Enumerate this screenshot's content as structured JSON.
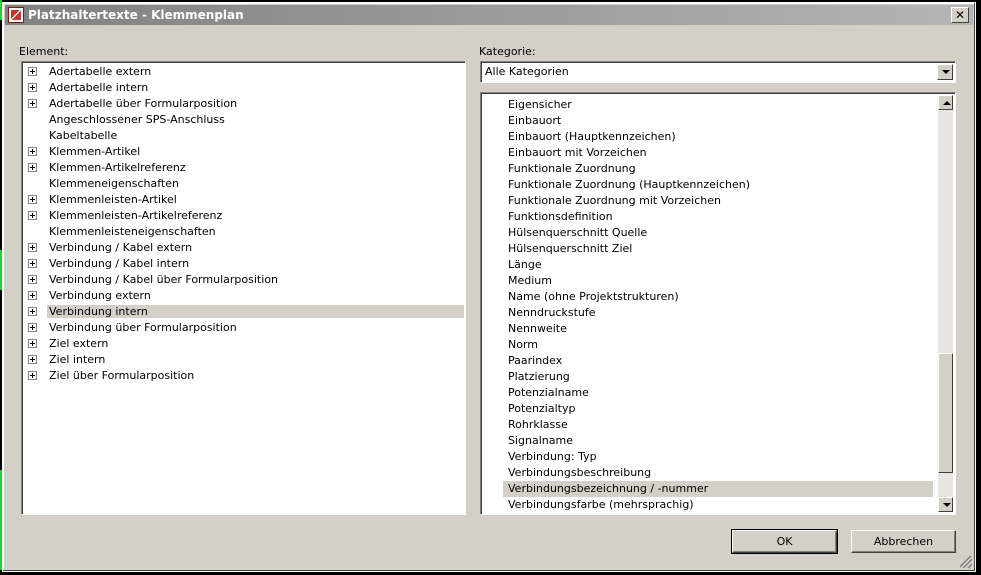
{
  "window": {
    "title": "Platzhaltertexte - Klemmenplan",
    "close_icon": "close-icon"
  },
  "left": {
    "label": "Element:",
    "items": [
      {
        "label": "Adertabelle extern",
        "expandable": true
      },
      {
        "label": "Adertabelle intern",
        "expandable": true
      },
      {
        "label": "Adertabelle über Formularposition",
        "expandable": true
      },
      {
        "label": "Angeschlossener SPS-Anschluss",
        "expandable": false
      },
      {
        "label": "Kabeltabelle",
        "expandable": false
      },
      {
        "label": "Klemmen-Artikel",
        "expandable": true
      },
      {
        "label": "Klemmen-Artikelreferenz",
        "expandable": true
      },
      {
        "label": "Klemmeneigenschaften",
        "expandable": false
      },
      {
        "label": "Klemmenleisten-Artikel",
        "expandable": true
      },
      {
        "label": "Klemmenleisten-Artikelreferenz",
        "expandable": true
      },
      {
        "label": "Klemmenleisteneigenschaften",
        "expandable": false
      },
      {
        "label": "Verbindung / Kabel extern",
        "expandable": true
      },
      {
        "label": "Verbindung / Kabel intern",
        "expandable": true
      },
      {
        "label": "Verbindung / Kabel über Formularposition",
        "expandable": true
      },
      {
        "label": "Verbindung extern",
        "expandable": true
      },
      {
        "label": "Verbindung intern",
        "expandable": true,
        "selected": true
      },
      {
        "label": "Verbindung über Formularposition",
        "expandable": true
      },
      {
        "label": "Ziel extern",
        "expandable": true
      },
      {
        "label": "Ziel intern",
        "expandable": true
      },
      {
        "label": "Ziel über Formularposition",
        "expandable": true
      }
    ]
  },
  "right": {
    "category_label": "Kategorie:",
    "category_value": "Alle Kategorien",
    "items": [
      "Eigensicher",
      "Einbauort",
      "Einbauort (Hauptkennzeichen)",
      "Einbauort mit Vorzeichen",
      "Funktionale Zuordnung",
      "Funktionale Zuordnung (Hauptkennzeichen)",
      "Funktionale Zuordnung mit Vorzeichen",
      "Funktionsdefinition",
      "Hülsenquerschnitt Quelle",
      "Hülsenquerschnitt Ziel",
      "Länge",
      "Medium",
      "Name (ohne Projektstrukturen)",
      "Nenndruckstufe",
      "Nennweite",
      "Norm",
      "Paarindex",
      "Platzierung",
      "Potenzialname",
      "Potenzialtyp",
      "Rohrklasse",
      "Signalname",
      "Verbindung: Typ",
      "Verbindungsbeschreibung",
      "Verbindungsbezeichnung / -nummer",
      "Verbindungsfarbe (mehrsprachig)"
    ],
    "selected_index": 24,
    "scroll_fraction": 0.87
  },
  "buttons": {
    "ok": "OK",
    "cancel": "Abbrechen"
  }
}
